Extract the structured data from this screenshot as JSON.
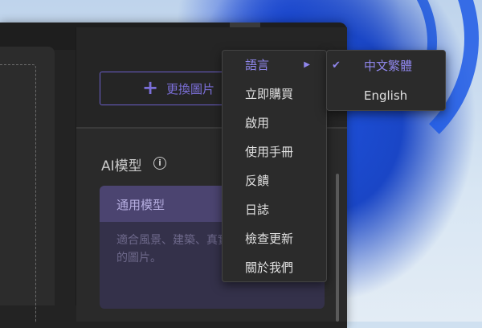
{
  "window": {
    "replace_button_label": "更換圖片",
    "ai_section_title": "AI模型",
    "card": {
      "title": "通用模型",
      "description": "適合風景、建築、真實的圖片。"
    }
  },
  "menu": {
    "items": [
      {
        "label": "語言",
        "has_submenu": true,
        "highlighted": true
      },
      {
        "label": "立即購買"
      },
      {
        "label": "啟用"
      },
      {
        "label": "使用手冊"
      },
      {
        "label": "反饋"
      },
      {
        "label": "日誌"
      },
      {
        "label": "檢查更新"
      },
      {
        "label": "關於我們"
      }
    ]
  },
  "language_submenu": {
    "items": [
      {
        "label": "中文繁體",
        "selected": true
      },
      {
        "label": "English",
        "selected": false
      }
    ]
  },
  "colors": {
    "accent": "#8f86ec",
    "window_bg": "#232323",
    "card_header": "#4b4470"
  },
  "icons": {
    "menu": "hamburger-icon",
    "minimize": "minimize-icon",
    "close": "close-icon",
    "info": "info-icon",
    "plus": "plus-icon",
    "submenu_arrow": "triangle-right-icon",
    "check": "checkmark-icon"
  }
}
